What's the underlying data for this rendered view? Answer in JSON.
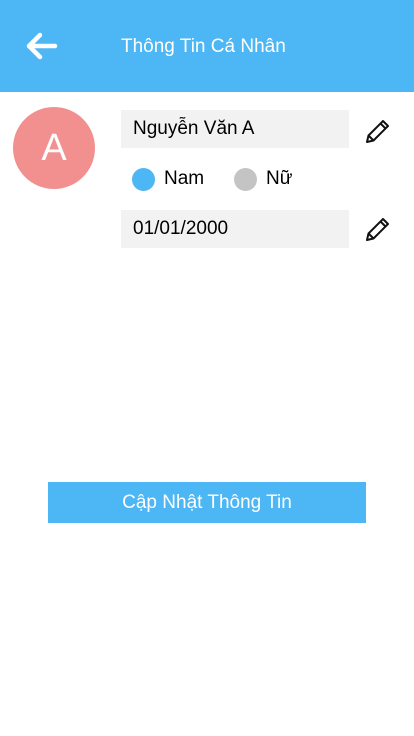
{
  "header": {
    "title": "Thông Tin Cá Nhân",
    "back_icon": "arrow-left-icon",
    "background_color": "#4db6f4"
  },
  "profile": {
    "avatar_letter": "A",
    "avatar_color": "#f28f8f",
    "name_value": "Nguyễn Văn A",
    "birthdate_value": "01/01/2000",
    "edit_icon": "pencil-icon"
  },
  "gender": {
    "options": [
      {
        "label": "Nam",
        "selected": true
      },
      {
        "label": "Nữ",
        "selected": false
      }
    ],
    "selected_color": "#4db6f4",
    "unselected_color": "#c4c4c4"
  },
  "actions": {
    "submit_label": "Cập Nhật Thông Tin"
  }
}
